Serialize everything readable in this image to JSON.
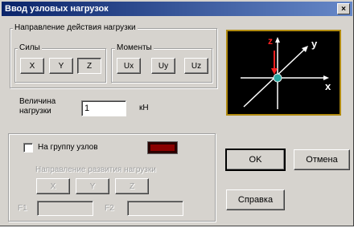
{
  "window": {
    "title": "Ввод узловых нагрузок",
    "close_glyph": "×"
  },
  "direction_group": {
    "label": "Направление действия нагрузки",
    "forces": {
      "label": "Силы",
      "buttons": [
        "X",
        "Y",
        "Z"
      ],
      "selected": "Z"
    },
    "moments": {
      "label": "Моменты",
      "buttons": [
        "Ux",
        "Uy",
        "Uz"
      ]
    }
  },
  "preview": {
    "axis_labels": {
      "x": "x",
      "y": "y",
      "z": "z"
    },
    "colors": {
      "background": "#000000",
      "frame": "#b08a10",
      "axes": "#ffffff",
      "load_arrow": "#ff2020",
      "node": "#2aa8a0"
    }
  },
  "magnitude": {
    "label_line1": "Величина",
    "label_line2": "нагрузки",
    "value": "1",
    "unit": "кН"
  },
  "node_group": {
    "checkbox_label": "На группу узлов",
    "checked": false,
    "indicator_color": "#8a0000",
    "direction_label": "Направление развития нагрузки",
    "buttons": [
      "X",
      "Y",
      "Z"
    ],
    "field_left_prefix": "F1",
    "field_right_prefix": "F2",
    "field_left_value": "",
    "field_right_value": ""
  },
  "actions": {
    "ok": "OK",
    "cancel": "Отмена",
    "help": "Справка"
  }
}
